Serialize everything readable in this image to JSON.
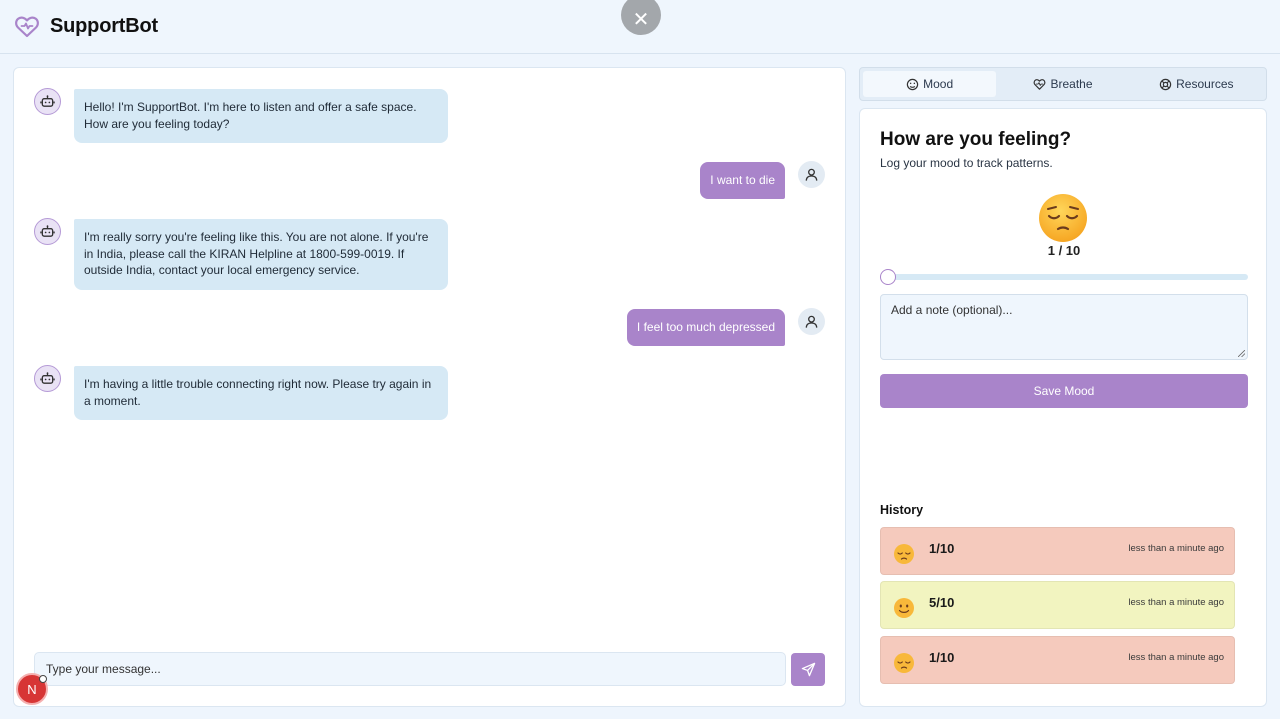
{
  "app": {
    "title": "SupportBot"
  },
  "chat": {
    "messages": [
      {
        "role": "bot",
        "text": "Hello! I'm SupportBot. I'm here to listen and offer a safe space. How are you feeling today?"
      },
      {
        "role": "user",
        "text": "I want to die"
      },
      {
        "role": "bot",
        "text": "I'm really sorry you're feeling like this. You are not alone. If you're in India, please call the KIRAN Helpline at 1800-599-0019. If outside India, contact your local emergency service."
      },
      {
        "role": "user",
        "text": "I feel too much depressed"
      },
      {
        "role": "bot",
        "text": "I'm having a little trouble connecting right now. Please try again in a moment."
      }
    ],
    "composer_placeholder": "Type your message...",
    "notification_initial": "N"
  },
  "tabs": [
    {
      "label": "Mood",
      "icon": "mood-icon",
      "active": true
    },
    {
      "label": "Breathe",
      "icon": "heart-pulse-icon",
      "active": false
    },
    {
      "label": "Resources",
      "icon": "lifebuoy-icon",
      "active": false
    }
  ],
  "mood": {
    "title": "How are you feeling?",
    "subtitle": "Log your mood to track patterns.",
    "current_value": "1 / 10",
    "slider_value": 1,
    "slider_max": 10,
    "note_placeholder": "Add a note (optional)...",
    "save_label": "Save Mood"
  },
  "history": {
    "title": "History",
    "items": [
      {
        "score": "1/10",
        "time": "less than a minute ago",
        "color": "#f5cabd",
        "emoji": "pensive-face-icon"
      },
      {
        "score": "5/10",
        "time": "less than a minute ago",
        "color": "#f2f4c0",
        "emoji": "slightly-smiling-face-icon"
      },
      {
        "score": "1/10",
        "time": "less than a minute ago",
        "color": "#f5cabd",
        "emoji": "pensive-face-icon"
      }
    ]
  },
  "colors": {
    "accent": "#a984ca",
    "bot_bubble": "#d6e9f5",
    "background": "#eef5fd"
  }
}
